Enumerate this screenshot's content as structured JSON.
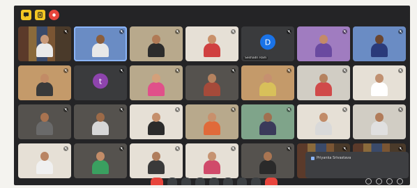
{
  "topbar": {
    "icons": [
      "chat-icon",
      "info-icon",
      "record-icon"
    ]
  },
  "tiles": [
    {
      "name": "",
      "kind": "person",
      "bg": "bg-books",
      "skin": "#c99a7a",
      "shirt": "#eaeaea"
    },
    {
      "name": "",
      "kind": "person",
      "bg": "bg-blue",
      "skin": "#8b5e3c",
      "shirt": "#e8e8e8",
      "highlight": true
    },
    {
      "name": "",
      "kind": "person",
      "bg": "bg-room",
      "skin": "#b07a56",
      "shirt": "#2c2c2c"
    },
    {
      "name": "",
      "kind": "person",
      "bg": "bg-light",
      "skin": "#c9906a",
      "shirt": "#d04040",
      "pill": true
    },
    {
      "name": "Seshadri Ram",
      "kind": "avatar",
      "letter": "D",
      "color": "#1a73e8"
    },
    {
      "name": "",
      "kind": "person",
      "bg": "bg-purple",
      "skin": "#c48a68",
      "shirt": "#6a4aa0"
    },
    {
      "name": "",
      "kind": "person",
      "bg": "bg-blue",
      "skin": "#6b4630",
      "shirt": "#2a3a7a"
    },
    {
      "name": "",
      "kind": "person",
      "bg": "bg-warm",
      "skin": "#c28b66",
      "shirt": "#3a3a3a"
    },
    {
      "name": "",
      "kind": "avatar",
      "letter": "t",
      "color": "#8e44ad"
    },
    {
      "name": "",
      "kind": "person",
      "bg": "bg-room",
      "skin": "#d4a07a",
      "shirt": "#e0508a"
    },
    {
      "name": "",
      "kind": "person",
      "bg": "bg-dim",
      "skin": "#b5825f",
      "shirt": "#a54a3a"
    },
    {
      "name": "",
      "kind": "person",
      "bg": "bg-warm",
      "skin": "#c69070",
      "shirt": "#d8c05a"
    },
    {
      "name": "",
      "kind": "person",
      "bg": "bg-office",
      "skin": "#b5825f",
      "shirt": "#d04a4a"
    },
    {
      "name": "",
      "kind": "person",
      "bg": "bg-light",
      "skin": "#c09070",
      "shirt": "#ffffff"
    },
    {
      "name": "",
      "kind": "person",
      "bg": "bg-dim",
      "skin": "#a87350",
      "shirt": "#6a6a6a"
    },
    {
      "name": "",
      "kind": "person",
      "bg": "bg-dim",
      "skin": "#9c6a48",
      "shirt": "#d7d7d7"
    },
    {
      "name": "",
      "kind": "person",
      "bg": "bg-light",
      "skin": "#c58f6b",
      "shirt": "#2b2b2b"
    },
    {
      "name": "",
      "kind": "person",
      "bg": "bg-room",
      "skin": "#c8906c",
      "shirt": "#e06a3a"
    },
    {
      "name": "",
      "kind": "person",
      "bg": "bg-green",
      "skin": "#a07050",
      "shirt": "#3a3a5a"
    },
    {
      "name": "",
      "kind": "person",
      "bg": "bg-light",
      "skin": "#c18b68",
      "shirt": "#d9d9d9"
    },
    {
      "name": "",
      "kind": "person",
      "bg": "bg-office",
      "skin": "#b17c5a",
      "shirt": "#e0e0e0"
    },
    {
      "name": "",
      "kind": "person",
      "bg": "bg-light",
      "skin": "#b98462",
      "shirt": "#f0f0f0"
    },
    {
      "name": "",
      "kind": "person",
      "bg": "bg-dim",
      "skin": "#c28c68",
      "shirt": "#3aa060"
    },
    {
      "name": "",
      "kind": "person",
      "bg": "bg-light",
      "skin": "#b07d5c",
      "shirt": "#3a3a3a"
    },
    {
      "name": "",
      "kind": "person",
      "bg": "bg-light",
      "skin": "#c69371",
      "shirt": "#d04a6a"
    },
    {
      "name": "",
      "kind": "person",
      "bg": "bg-dim",
      "skin": "#a97552",
      "shirt": "#2a2a2a"
    },
    {
      "name": "",
      "kind": "person",
      "bg": "bg-books",
      "skin": "#c08a66",
      "shirt": "#eaeaea"
    },
    {
      "name": "",
      "kind": "person",
      "bg": "bg-books",
      "skin": "#c08a66",
      "shirt": "#4a4a4a"
    }
  ],
  "chat_popup": {
    "sender": "Priyanka Srivastava",
    "message": ""
  },
  "bottom": {
    "time": ""
  },
  "colors": {
    "background": "#242426",
    "tile": "#3a3b3d",
    "end_call": "#e8453c",
    "accent_yellow": "#f3c623"
  }
}
